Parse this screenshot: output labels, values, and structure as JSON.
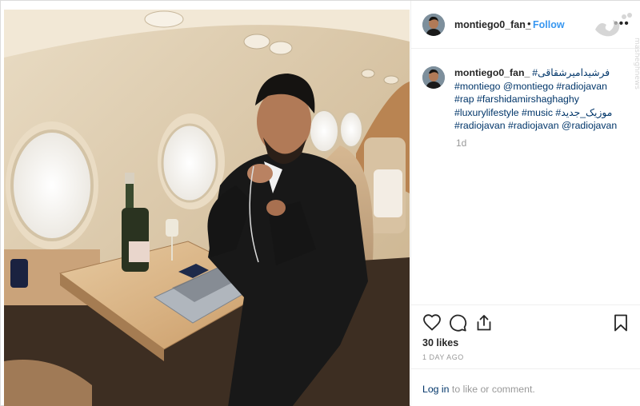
{
  "post": {
    "username": "montiego0_fan_",
    "separator": "•",
    "follow_label": "Follow",
    "more_icon": "more-horizontal-icon",
    "watermark_text": "masheghnews"
  },
  "caption": {
    "username": "montiego0_fan_",
    "lines": [
      "#فرشیدامیرشقاقی",
      "#montiego @montiego #radiojavan",
      "#rap #farshidamirshaghaghy",
      "#luxurylifestyle #music #موزیک_جدید",
      "#radiojavan #radiojavan @radiojavan"
    ],
    "age": "1d"
  },
  "actions": {
    "like_icon": "heart-icon",
    "comment_icon": "comment-icon",
    "share_icon": "share-icon",
    "save_icon": "bookmark-icon"
  },
  "likes": "30 likes",
  "timestamp": "1 DAY AGO",
  "login": {
    "link_label": "Log in",
    "rest": " to like or comment."
  },
  "colors": {
    "link_blue": "#3897f0",
    "hashtag_navy": "#003569",
    "muted_gray": "#999999",
    "border": "#efefef"
  }
}
